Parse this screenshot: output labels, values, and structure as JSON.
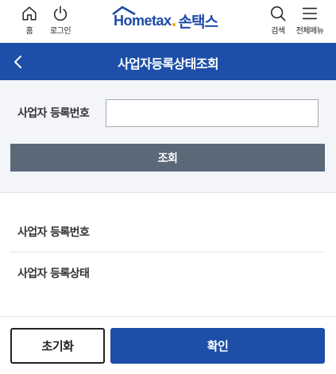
{
  "header": {
    "home_label": "홈",
    "login_label": "로그인",
    "search_label": "검색",
    "menu_label": "전체메뉴",
    "logo": {
      "home_text": "Hometax",
      "son_text": "손택스",
      "colors": {
        "brand_blue": "#1c4aa6",
        "accent_orange": "#f7a21b"
      }
    }
  },
  "titlebar": {
    "title": "사업자등록상태조회",
    "back_icon": "chevron-left-icon",
    "background": "#1d4fa8"
  },
  "search": {
    "field_label": "사업자 등록번호",
    "field_value": "",
    "field_placeholder": "",
    "query_button": "조회"
  },
  "results": {
    "rows": [
      {
        "label": "사업자 등록번호",
        "value": ""
      },
      {
        "label": "사업자 등록상태",
        "value": ""
      }
    ]
  },
  "footer": {
    "reset_button": "초기화",
    "confirm_button": "확인"
  }
}
